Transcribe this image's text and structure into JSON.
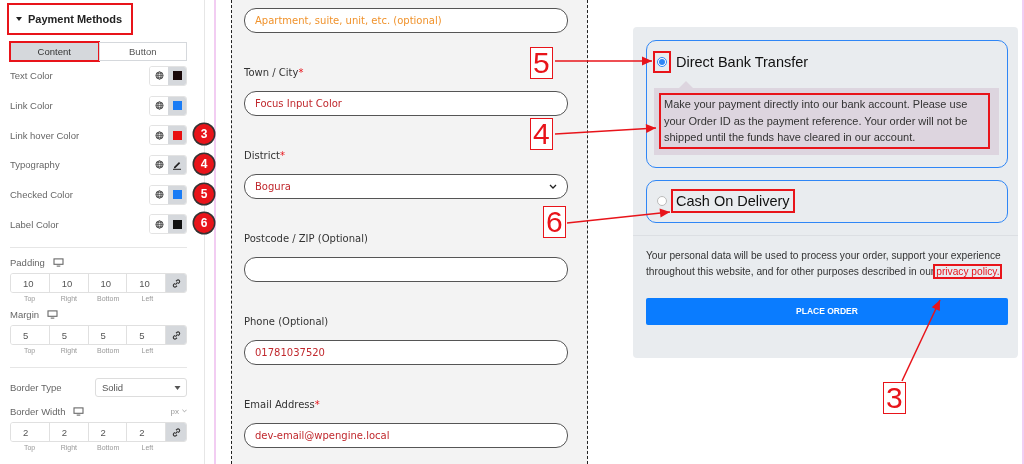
{
  "panel": {
    "title": "Payment Methods",
    "highlighted": true,
    "tabs": [
      {
        "label": "Content",
        "selected": true,
        "highlighted": true
      },
      {
        "label": "Button",
        "selected": false,
        "highlighted": false
      }
    ],
    "style_rows": [
      {
        "label": "Text Color",
        "kind": "color",
        "color": "#1a0a0a"
      },
      {
        "label": "Link Color",
        "kind": "color",
        "color": "#1a7cf5"
      },
      {
        "label": "Link hover Color",
        "kind": "color",
        "color": "#e81010",
        "badge": "3"
      },
      {
        "label": "Typography",
        "kind": "typography",
        "badge": "4"
      },
      {
        "label": "Checked Color",
        "kind": "color",
        "color": "#1a7cf5",
        "badge": "5"
      },
      {
        "label": "Label Color",
        "kind": "color",
        "color": "#111111",
        "badge": "6"
      }
    ],
    "padding": {
      "label": "Padding",
      "inputs": [
        {
          "value": "10",
          "caption": "Top"
        },
        {
          "value": "10",
          "caption": "Right"
        },
        {
          "value": "10",
          "caption": "Bottom"
        },
        {
          "value": "10",
          "caption": "Left"
        }
      ]
    },
    "margin": {
      "label": "Margin",
      "inputs": [
        {
          "value": "5",
          "caption": "Top"
        },
        {
          "value": "5",
          "caption": "Right"
        },
        {
          "value": "5",
          "caption": "Bottom"
        },
        {
          "value": "5",
          "caption": "Left"
        }
      ]
    },
    "border_type": {
      "label": "Border Type",
      "value": "Solid"
    },
    "border_width": {
      "label": "Border Width",
      "unit": "px",
      "inputs": [
        {
          "value": "2",
          "caption": "Top"
        },
        {
          "value": "2",
          "caption": "Right"
        },
        {
          "value": "2",
          "caption": "Bottom"
        },
        {
          "value": "2",
          "caption": "Left"
        }
      ]
    }
  },
  "form": {
    "fields": [
      {
        "kind": "input",
        "placeholder": "Apartment, suite, unit, etc. (optional)"
      },
      {
        "kind": "input",
        "label": "Town / City",
        "required_mark": "*",
        "value": "Focus Input Color"
      },
      {
        "kind": "select",
        "label": "District",
        "required_mark": "*",
        "value": "Bogura"
      },
      {
        "kind": "input",
        "label": "Postcode / ZIP (Optional)"
      },
      {
        "kind": "input",
        "label": "Phone (Optional)",
        "value": "01781037520"
      },
      {
        "kind": "input",
        "label": "Email Address",
        "required_mark": "*",
        "value": "dev-email@wpengine.local"
      }
    ]
  },
  "payment": {
    "methods": [
      {
        "label": "Direct Bank Transfer",
        "selected": true,
        "radio_highlighted": true,
        "label_highlighted": false,
        "description": "Make your payment directly into our bank account. Please use your Order ID as the payment reference. Your order will not be shipped until the funds have cleared in our account.",
        "description_highlighted": true
      },
      {
        "label": "Cash On Delivery",
        "selected": false,
        "radio_highlighted": false,
        "label_highlighted": true
      }
    ],
    "privacy_text": "Your personal data will be used to process your order, support your experience throughout this website, and for other purposes described in our",
    "privacy_link": "privacy policy",
    "privacy_link_highlighted": true,
    "privacy_end": ".",
    "button": "PLACE ORDER"
  },
  "annotations": [
    "5",
    "4",
    "6",
    "3"
  ]
}
